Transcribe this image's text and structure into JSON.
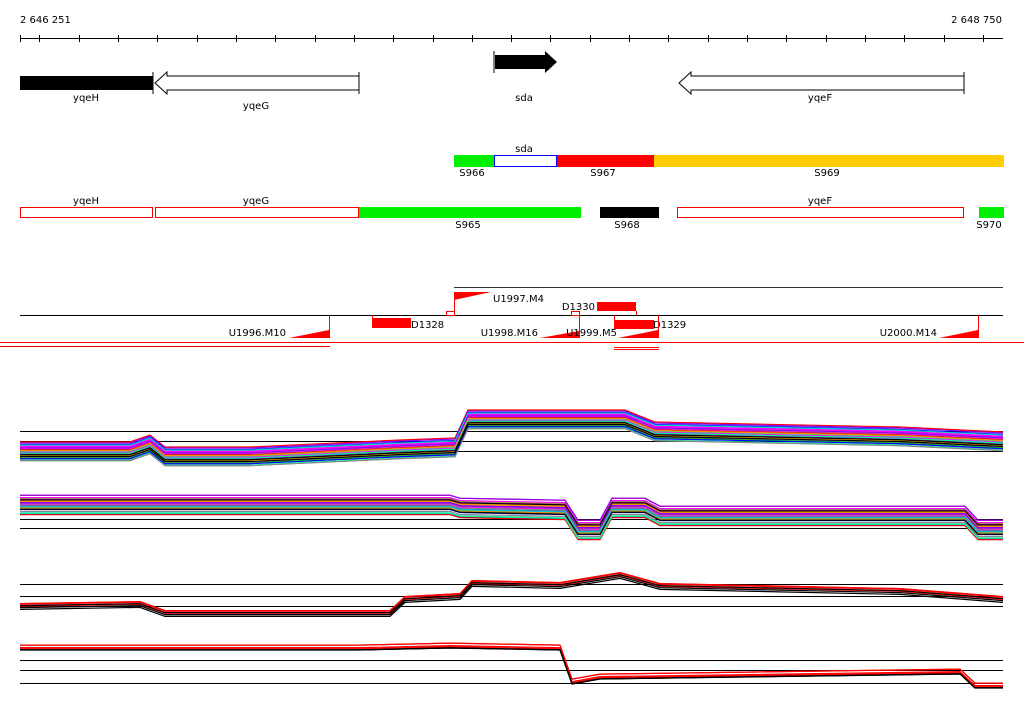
{
  "coords": {
    "start": "2 646 251",
    "end": "2 648 750"
  },
  "genes": [
    {
      "name": "yqeH",
      "style": "filled"
    },
    {
      "name": "yqeG",
      "style": "open-left"
    },
    {
      "name": "sda",
      "style": "filled-right"
    },
    {
      "name": "yqeF",
      "style": "open-left"
    }
  ],
  "segments1": [
    {
      "label": "S966",
      "color": "#00ee00"
    },
    {
      "label": "sda",
      "color": "#0000ff"
    },
    {
      "label": "S967",
      "color": "#ff0000"
    },
    {
      "label": "S969",
      "color": "#ffcc00"
    }
  ],
  "segments2": [
    {
      "label": "yqeH",
      "color": "#ff0000"
    },
    {
      "label": "yqeG",
      "color": "#ff0000"
    },
    {
      "label": "S965",
      "color": "#00ee00"
    },
    {
      "label": "S968",
      "color": "#000000"
    },
    {
      "label": "yqeF",
      "color": "#ff0000"
    },
    {
      "label": "S970",
      "color": "#00ee00"
    }
  ],
  "features": [
    {
      "label": "U1996.M10"
    },
    {
      "label": "D1328"
    },
    {
      "label": "U1997.M4"
    },
    {
      "label": "D1330"
    },
    {
      "label": "U1998.M16"
    },
    {
      "label": "U1999.M5"
    },
    {
      "label": "D1329"
    },
    {
      "label": "U2000.M14"
    }
  ],
  "colors": {
    "accent": "#ff0000",
    "profile_colors": [
      "#ff0000",
      "#00cc00",
      "#0000ff",
      "#ff00ff",
      "#00cccc",
      "#ffcc00",
      "#ff8800",
      "#8800ff",
      "#888888",
      "#00ff88"
    ]
  }
}
